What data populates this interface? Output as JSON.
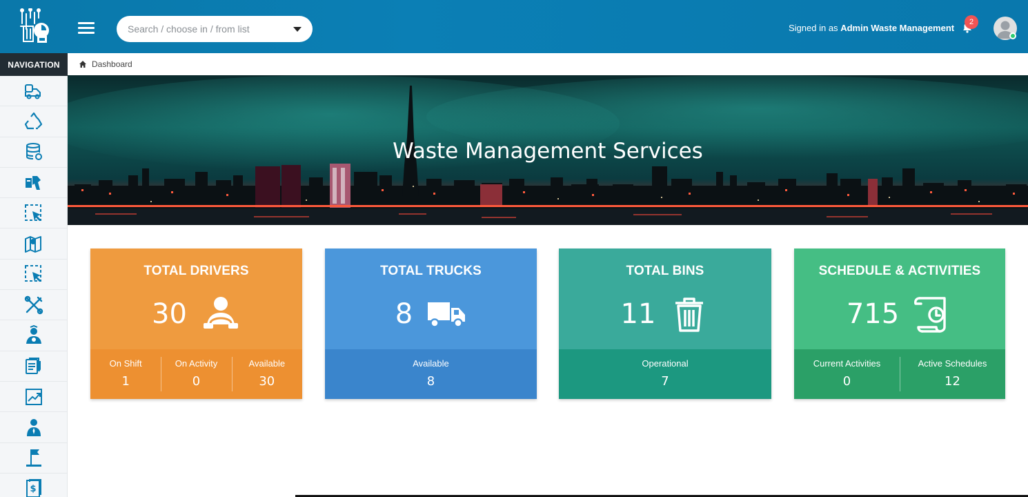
{
  "header": {
    "search_placeholder": "Search / choose in / from list",
    "signed_prefix": "Signed in as",
    "signed_user": "Admin Waste Management",
    "notification_count": "2"
  },
  "sidebar": {
    "title": "NAVIGATION",
    "items": [
      {
        "icon": "truck-bins-icon"
      },
      {
        "icon": "recycle-icon"
      },
      {
        "icon": "database-icon"
      },
      {
        "icon": "pickup-icon"
      },
      {
        "icon": "selection-pointer-icon"
      },
      {
        "icon": "map-pin-icon"
      },
      {
        "icon": "selection-pointer-icon-2"
      },
      {
        "icon": "tools-icon"
      },
      {
        "icon": "driver-user-icon"
      },
      {
        "icon": "report-document-icon"
      },
      {
        "icon": "chart-trend-icon"
      },
      {
        "icon": "person-icon"
      },
      {
        "icon": "flag-marker-icon"
      },
      {
        "icon": "invoice-dollar-icon"
      }
    ]
  },
  "breadcrumb": {
    "label": "Dashboard"
  },
  "banner": {
    "title": "Waste Management Services"
  },
  "colors": {
    "header": "#0a7db3",
    "drivers": "#ef9b3f",
    "drivers_foot": "#ed9031",
    "trucks": "#4b97db",
    "trucks_foot": "#3a85cc",
    "bins": "#3aaa9b",
    "bins_foot": "#1c9880",
    "schedule": "#45be84",
    "schedule_foot": "#2ba067"
  },
  "cards": {
    "drivers": {
      "title": "TOTAL DRIVERS",
      "value": "30",
      "stats": [
        {
          "label": "On Shift",
          "value": "1"
        },
        {
          "label": "On Activity",
          "value": "0"
        },
        {
          "label": "Available",
          "value": "30"
        }
      ]
    },
    "trucks": {
      "title": "TOTAL TRUCKS",
      "value": "8",
      "stats": [
        {
          "label": "Available",
          "value": "8"
        }
      ]
    },
    "bins": {
      "title": "TOTAL BINS",
      "value": "11",
      "stats": [
        {
          "label": "Operational",
          "value": "7"
        }
      ]
    },
    "schedule": {
      "title": "SCHEDULE & ACTIVITIES",
      "value": "715",
      "stats": [
        {
          "label": "Current Activities",
          "value": "0"
        },
        {
          "label": "Active Schedules",
          "value": "12"
        }
      ]
    }
  }
}
